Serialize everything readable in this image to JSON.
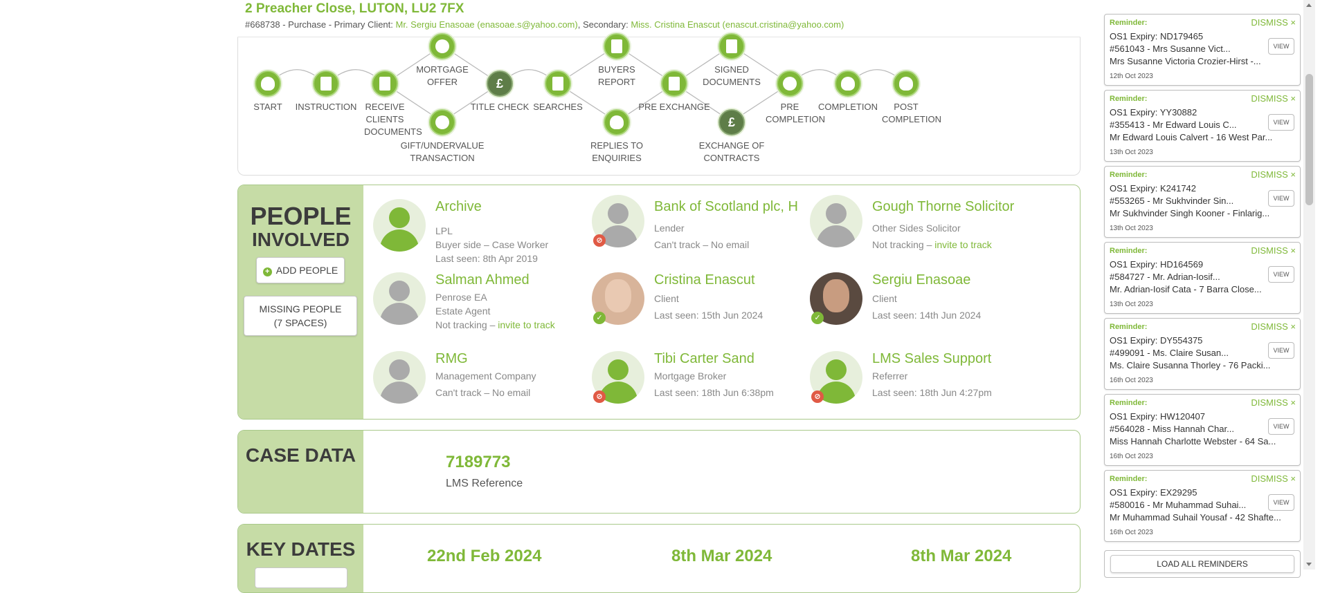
{
  "header": {
    "title": "2 Preacher Close, LUTON, LU2 7FX",
    "sub_prefix": "#668738 - Purchase - Primary Client: ",
    "primary_client": "Mr. Sergiu Enasoae (enasoae.s@yahoo.com)",
    "sub_mid": ", Secondary: ",
    "secondary_client": "Miss. Cristina Enascut (enascut.cristina@yahoo.com)"
  },
  "progress": {
    "steps": [
      {
        "label": "START",
        "icon": "dog-icon"
      },
      {
        "label": "INSTRUCTION",
        "icon": "document-icon"
      },
      {
        "label": "RECEIVE CLIENTS DOCUMENTS",
        "icon": "document-icon"
      },
      {
        "label": "MORTGAGE OFFER",
        "icon": "chat-icon"
      },
      {
        "label": "GIFT/UNDERVALUE TRANSACTION",
        "icon": "chat-icon"
      },
      {
        "label": "TITLE CHECK",
        "icon": "pound-icon"
      },
      {
        "label": "SEARCHES",
        "icon": "document-icon"
      },
      {
        "label": "BUYERS REPORT",
        "icon": "document-icon"
      },
      {
        "label": "REPLIES TO ENQUIRIES",
        "icon": "dog-icon"
      },
      {
        "label": "PRE EXCHANGE",
        "icon": "document-icon"
      },
      {
        "label": "SIGNED DOCUMENTS",
        "icon": "document-icon"
      },
      {
        "label": "EXCHANGE OF CONTRACTS",
        "icon": "pound-icon"
      },
      {
        "label": "PRE COMPLETION",
        "icon": "chat-icon"
      },
      {
        "label": "COMPLETION",
        "icon": "dog-icon"
      },
      {
        "label": "POST COMPLETION",
        "icon": "dog-icon"
      }
    ]
  },
  "people": {
    "title_big": "PEOPLE",
    "title_small": "INVOLVED",
    "add_label": "ADD PEOPLE",
    "missing_label_1": "MISSING PEOPLE",
    "missing_label_2": "(7 SPACES)",
    "list": [
      {
        "name": "Archive",
        "l1": "LPL",
        "l2": "Buyer side – Case Worker",
        "l3": "Last seen: 8th Apr 2019"
      },
      {
        "name": "Bank of Scotland plc, H",
        "l1": "Lender",
        "l2": "Can't track – No email",
        "l3": ""
      },
      {
        "name": "Gough Thorne Solicitor",
        "l1": "Other Sides Solicitor",
        "l2": "Not tracking – ",
        "l2_link": "invite to track"
      },
      {
        "name": "Salman Ahmed",
        "l1": "Penrose EA",
        "l2": "Estate Agent",
        "l3": "Not tracking – ",
        "l3_link": "invite to track"
      },
      {
        "name": "Cristina Enascut",
        "l1": "Client",
        "l2": "Last seen: 15th Jun 2024"
      },
      {
        "name": "Sergiu Enasoae",
        "l1": "Client",
        "l2": "Last seen: 14th Jun 2024"
      },
      {
        "name": "RMG",
        "l1": "Management Company",
        "l2": "Can't track – No email"
      },
      {
        "name": "Tibi Carter Sand",
        "l1": "Mortgage Broker",
        "l2": "Last seen: 18th Jun 6:38pm"
      },
      {
        "name": "LMS Sales Support",
        "l1": "Referrer",
        "l2": "Last seen: 18th Jun 4:27pm"
      }
    ]
  },
  "case_data": {
    "title": "CASE DATA",
    "value": "7189773",
    "label": "LMS Reference"
  },
  "key_dates": {
    "title": "KEY DATES",
    "dates": [
      "22nd Feb 2024",
      "8th Mar 2024",
      "8th Mar 2024"
    ]
  },
  "reminders": {
    "label": "Reminder:",
    "dismiss": "DISMISS ×",
    "view": "VIEW",
    "load_all": "LOAD ALL REMINDERS",
    "items": [
      {
        "t1": "OS1 Expiry: ND179465",
        "t2": "#561043 - Mrs Susanne Vict...",
        "t3": "Mrs Susanne Victoria Crozier-Hirst -...",
        "date": "12th Oct 2023"
      },
      {
        "t1": "OS1 Expiry: YY30882",
        "t2": "#355413 - Mr Edward Louis C...",
        "t3": "Mr Edward Louis Calvert - 16 West Par...",
        "date": "13th Oct 2023"
      },
      {
        "t1": "OS1 Expiry: K241742",
        "t2": "#553265 - Mr Sukhvinder Sin...",
        "t3": "Mr Sukhvinder Singh Kooner - Finlarig...",
        "date": "13th Oct 2023"
      },
      {
        "t1": "OS1 Expiry: HD164569",
        "t2": "#584727 - Mr. Adrian-Iosif...",
        "t3": "Mr. Adrian-Iosif Cata - 7 Barra Close...",
        "date": "13th Oct 2023"
      },
      {
        "t1": "OS1 Expiry: DY554375",
        "t2": "#499091 - Ms. Claire Susan...",
        "t3": "Ms. Claire Susanna Thorley - 76 Packi...",
        "date": "16th Oct 2023"
      },
      {
        "t1": "OS1 Expiry: HW120407",
        "t2": "#564028 - Miss Hannah Char...",
        "t3": "Miss Hannah Charlotte Webster - 64 Sa...",
        "date": "16th Oct 2023"
      },
      {
        "t1": "OS1 Expiry: EX29295",
        "t2": "#580016 - Mr Muhammad Suhai...",
        "t3": "Mr Muhammad Suhail Yousaf - 42 Shafte...",
        "date": "16th Oct 2023"
      }
    ]
  }
}
